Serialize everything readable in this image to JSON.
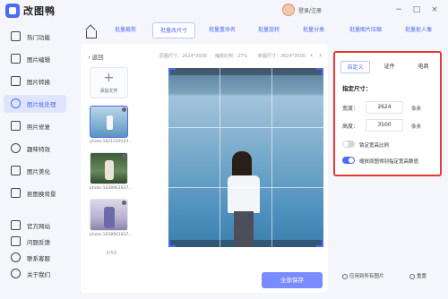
{
  "app": {
    "title": "改图鸭",
    "login_text": "登录/注册"
  },
  "window_controls": [
    "−",
    "□",
    "×"
  ],
  "sidebar": {
    "items": [
      {
        "label": "热门功能",
        "icon": "home-apps-icon",
        "active": false
      },
      {
        "label": "图片编辑",
        "icon": "image-edit-icon",
        "active": false
      },
      {
        "label": "图片转换",
        "icon": "image-convert-icon",
        "active": false
      },
      {
        "label": "图片批处理",
        "icon": "batch-process-icon",
        "active": true
      },
      {
        "label": "照片修复",
        "icon": "photo-repair-icon",
        "active": false
      },
      {
        "label": "趣味特效",
        "icon": "fun-effect-icon",
        "active": false
      },
      {
        "label": "图片美化",
        "icon": "image-beautify-icon",
        "active": false
      },
      {
        "label": "抠图换背景",
        "icon": "cutout-icon",
        "active": false
      }
    ],
    "bottom_items": [
      {
        "label": "官方网站",
        "icon": "website-icon"
      },
      {
        "label": "问题反馈",
        "icon": "feedback-icon"
      },
      {
        "label": "联系客服",
        "icon": "support-icon"
      },
      {
        "label": "关于我们",
        "icon": "about-icon"
      }
    ]
  },
  "tabs": [
    {
      "label": "批量裁剪",
      "active": false
    },
    {
      "label": "批量改尺寸",
      "active": true
    },
    {
      "label": "批量重命名",
      "active": false
    },
    {
      "label": "批量旋转",
      "active": false
    },
    {
      "label": "批量分类",
      "active": false
    },
    {
      "label": "批量图片压缩",
      "active": false
    },
    {
      "label": "批量抠人像",
      "active": false
    }
  ],
  "main": {
    "back_label": "返回",
    "original_size": "原图尺寸：2624*3936",
    "scale_ratio": "缩放比例：27%",
    "new_size": "新图尺寸：2624*3500",
    "add_file_label": "添加文件",
    "files": [
      {
        "name": "photo-1621219323...",
        "selected": true
      },
      {
        "name": "photo-1638961837...",
        "selected": false
      },
      {
        "name": "photo-1638961837...",
        "selected": false
      }
    ],
    "counter": "3/50",
    "save_label": "全部保存"
  },
  "right_panel": {
    "segments": [
      {
        "label": "自定义",
        "active": true
      },
      {
        "label": "证件",
        "active": false
      },
      {
        "label": "电商",
        "active": false
      }
    ],
    "title": "指定尺寸：",
    "width_label": "宽度：",
    "width_value": "2624",
    "height_label": "高度：",
    "height_value": "3500",
    "unit": "像素",
    "lock_ratio_label": "锁定宽高比例",
    "lock_ratio_on": false,
    "scale_mode_label": "缩放原图得到指定宽高数值",
    "scale_mode_on": true
  },
  "footer": {
    "apply_all_label": "应用到所有图片",
    "reset_label": "重置"
  },
  "colors": {
    "accent": "#4f6bf5",
    "highlight_border": "#e53935",
    "save_button": "#7a8bff"
  }
}
